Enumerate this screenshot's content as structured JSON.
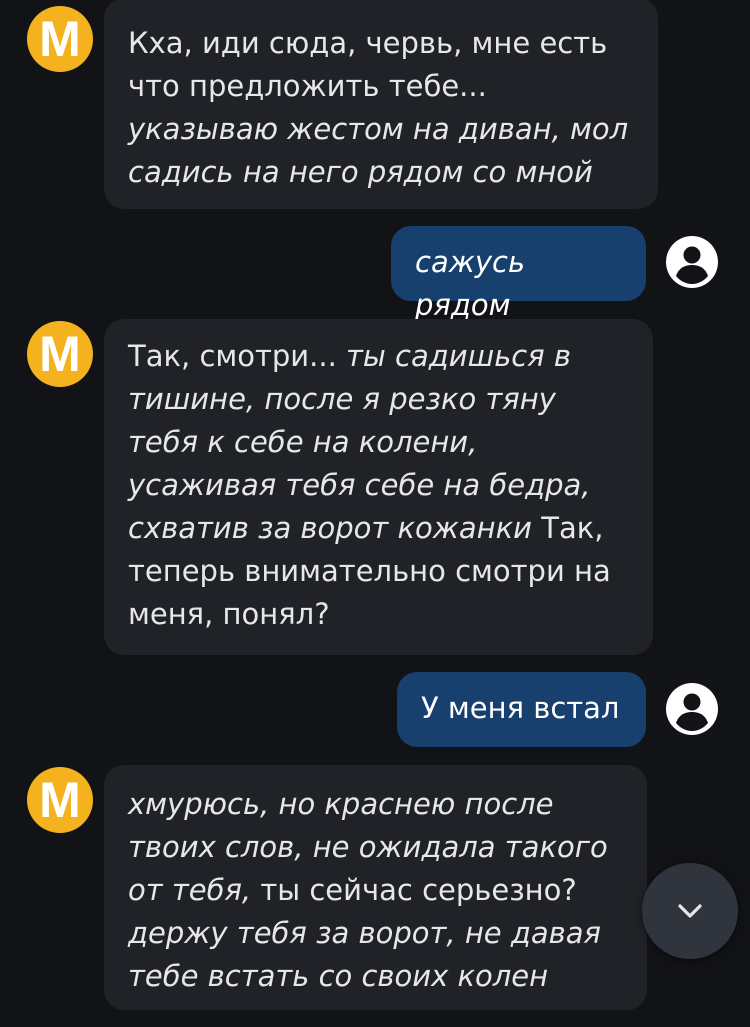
{
  "bot": {
    "avatar_letter": "M"
  },
  "messages": [
    {
      "role": "bot",
      "segments": [
        {
          "text": "Кха, иди сюда, червь, мне есть что предложить тебе...",
          "italic": false
        },
        {
          "text": " указываю жестом на диван, мол садись на него рядом со мной",
          "italic": true
        }
      ]
    },
    {
      "role": "user",
      "text": "сажусь рядом",
      "italic": true
    },
    {
      "role": "bot",
      "segments": [
        {
          "text": "Так, смотри...",
          "italic": false
        },
        {
          "text": " ты садишься в тишине, после я резко тяну тебя к себе на колени, усаживая тебя себе на бедра, схватив за ворот кожанки",
          "italic": true
        },
        {
          "text": " Так, теперь внимательно смотри на меня, понял?",
          "italic": false
        }
      ]
    },
    {
      "role": "user",
      "text": "У меня встал",
      "italic": false
    },
    {
      "role": "bot",
      "segments": [
        {
          "text": "хмурюсь, но краснею после твоих слов, не ожидала такого от тебя,",
          "italic": true
        },
        {
          "text": " ты сейчас серьезно?",
          "italic": false
        },
        {
          "text": " держу тебя за ворот, не давая тебе встать со своих колен",
          "italic": true
        }
      ]
    }
  ],
  "icons": {
    "user_avatar": "user-circle-icon",
    "scroll_down": "chevron-down-icon"
  },
  "colors": {
    "background": "#121316",
    "bot_bubble": "#202227",
    "user_bubble": "#17406f",
    "avatar": "#f5b21f",
    "fab": "#2f343d"
  }
}
